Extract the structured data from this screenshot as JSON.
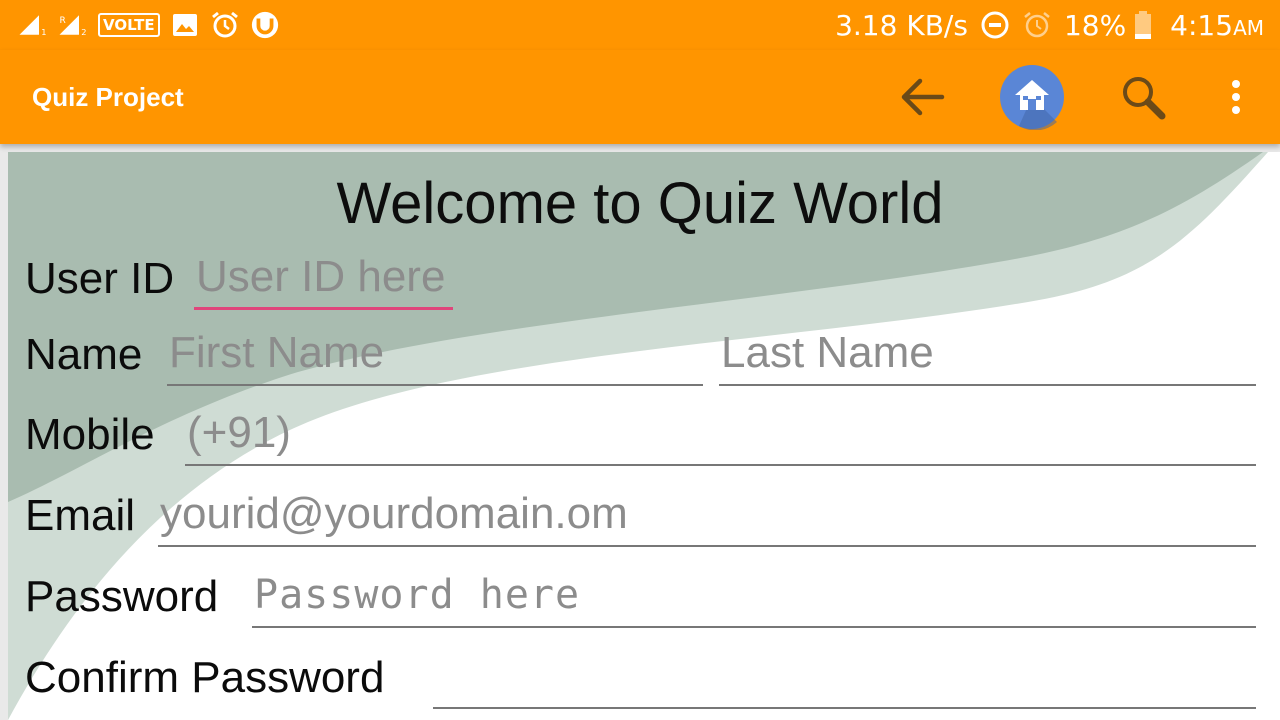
{
  "status_bar": {
    "network_speed": "3.18 KB/s",
    "battery": "18%",
    "time": "4:15",
    "ampm": "AM",
    "volte": "VOLTE",
    "sim1_label": "R",
    "sim1_index": "1",
    "sim2_index": "2",
    "icons": [
      "signal-icon",
      "signal-roaming-icon",
      "volte-icon",
      "image-icon",
      "alarm-icon",
      "utorrent-icon",
      "data-saver-icon",
      "alarm-icon",
      "battery-icon"
    ]
  },
  "app_bar": {
    "title": "Quiz Project",
    "actions": [
      "back-arrow-icon",
      "home-icon",
      "search-icon",
      "more-vert-icon"
    ],
    "colors": {
      "bar": "#ff9500",
      "home_circle": "#5a86d6"
    }
  },
  "form": {
    "title": "Welcome to Quiz World",
    "user_id": {
      "label": "User ID",
      "placeholder": "User ID here"
    },
    "name": {
      "label": "Name",
      "first_placeholder": "First Name",
      "last_placeholder": "Last Name"
    },
    "mobile": {
      "label": "Mobile",
      "placeholder": "(+91)"
    },
    "email": {
      "label": "Email",
      "placeholder": "yourid@yourdomain.om"
    },
    "password": {
      "label": "Password",
      "placeholder": "Password here"
    },
    "confirm_password": {
      "label": "Confirm Password",
      "placeholder": ""
    },
    "colors": {
      "focus_underline": "#e0457b",
      "wave": "#a9bcb0"
    }
  }
}
